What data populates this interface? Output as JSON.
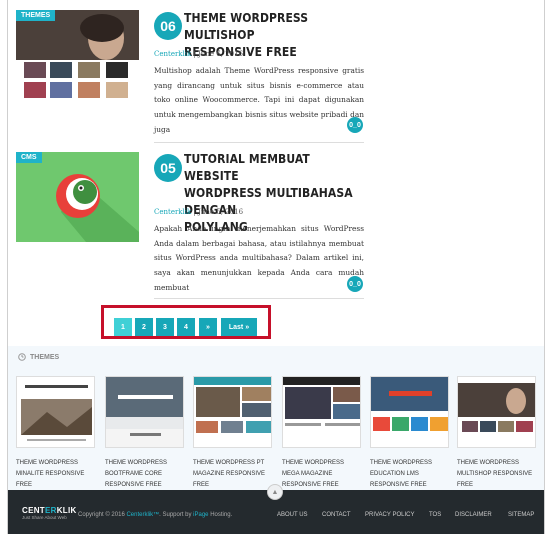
{
  "posts": [
    {
      "category": "THEMES",
      "number": "06",
      "title_lines": [
        "THEME WORDPRESS MULTISHOP",
        "RESPONSIVE FREE"
      ],
      "author": "Centerklik",
      "date": "June 6, 2016",
      "excerpt": "Multishop adalah Theme WordPress responsive gratis yang dirancang untuk situs bisnis e-commerce atau toko online Woocommerce. Tapi ini dapat digunakan untuk mengembangkan bisnis situs website pribadi dan juga",
      "emote": "0_0"
    },
    {
      "category": "CMS",
      "number": "05",
      "title_lines": [
        "TUTORIAL MEMBUAT WEBSITE",
        "WORDPRESS MULTIBAHASA DENGAN",
        "POLYLANG"
      ],
      "author": "Centerklik",
      "date": "June 5, 2016",
      "excerpt": "Apakah Anda ingin menerjemahkan situs WordPress Anda dalam berbagai bahasa, atau istilahnya membuat situs WordPress anda multibahasa? Dalam artikel ini, saya akan menunjukkan kepada Anda cara mudah membuat",
      "emote": "0_0"
    }
  ],
  "pagination": {
    "pages": [
      "1",
      "2",
      "3",
      "4",
      "»",
      "Last »"
    ],
    "active": "1"
  },
  "themes": {
    "heading": "THEMES",
    "items": [
      {
        "caption": "THEME WORDPRESS MINALITE RESPONSIVE FREE"
      },
      {
        "caption": "THEME WORDPRESS BOOTFRAME CORE RESPONSIVE FREE"
      },
      {
        "caption": "THEME WORDPRESS PT MAGAZINE RESPONSIVE FREE"
      },
      {
        "caption": "THEME WORDPRESS MEGA MAGAZINE RESPONSIVE FREE"
      },
      {
        "caption": "THEME WORDPRESS EDUCATION LMS RESPONSIVE FREE"
      },
      {
        "caption": "THEME WORDPRESS MULTISHOP RESPONSIVE FREE"
      }
    ]
  },
  "footer": {
    "logo_center": "CENT",
    "logo_er": "ER",
    "logo_klik": "KLIK",
    "tagline": "Just Share About Web",
    "copyright_prefix": "Copyright © 2016",
    "copyright_brand": "Centerklik™",
    "support_prefix": ". Support by",
    "support_brand": "iPage",
    "support_suffix": "Hosting.",
    "links": [
      "ABOUT US",
      "CONTACT",
      "PRIVACY POLICY",
      "TOS",
      "DISCLAIMER",
      "SITEMAP"
    ]
  },
  "colors": {
    "accent": "#17a7b8",
    "highlight": "#c6102a",
    "footer_bg": "#242a2e"
  }
}
